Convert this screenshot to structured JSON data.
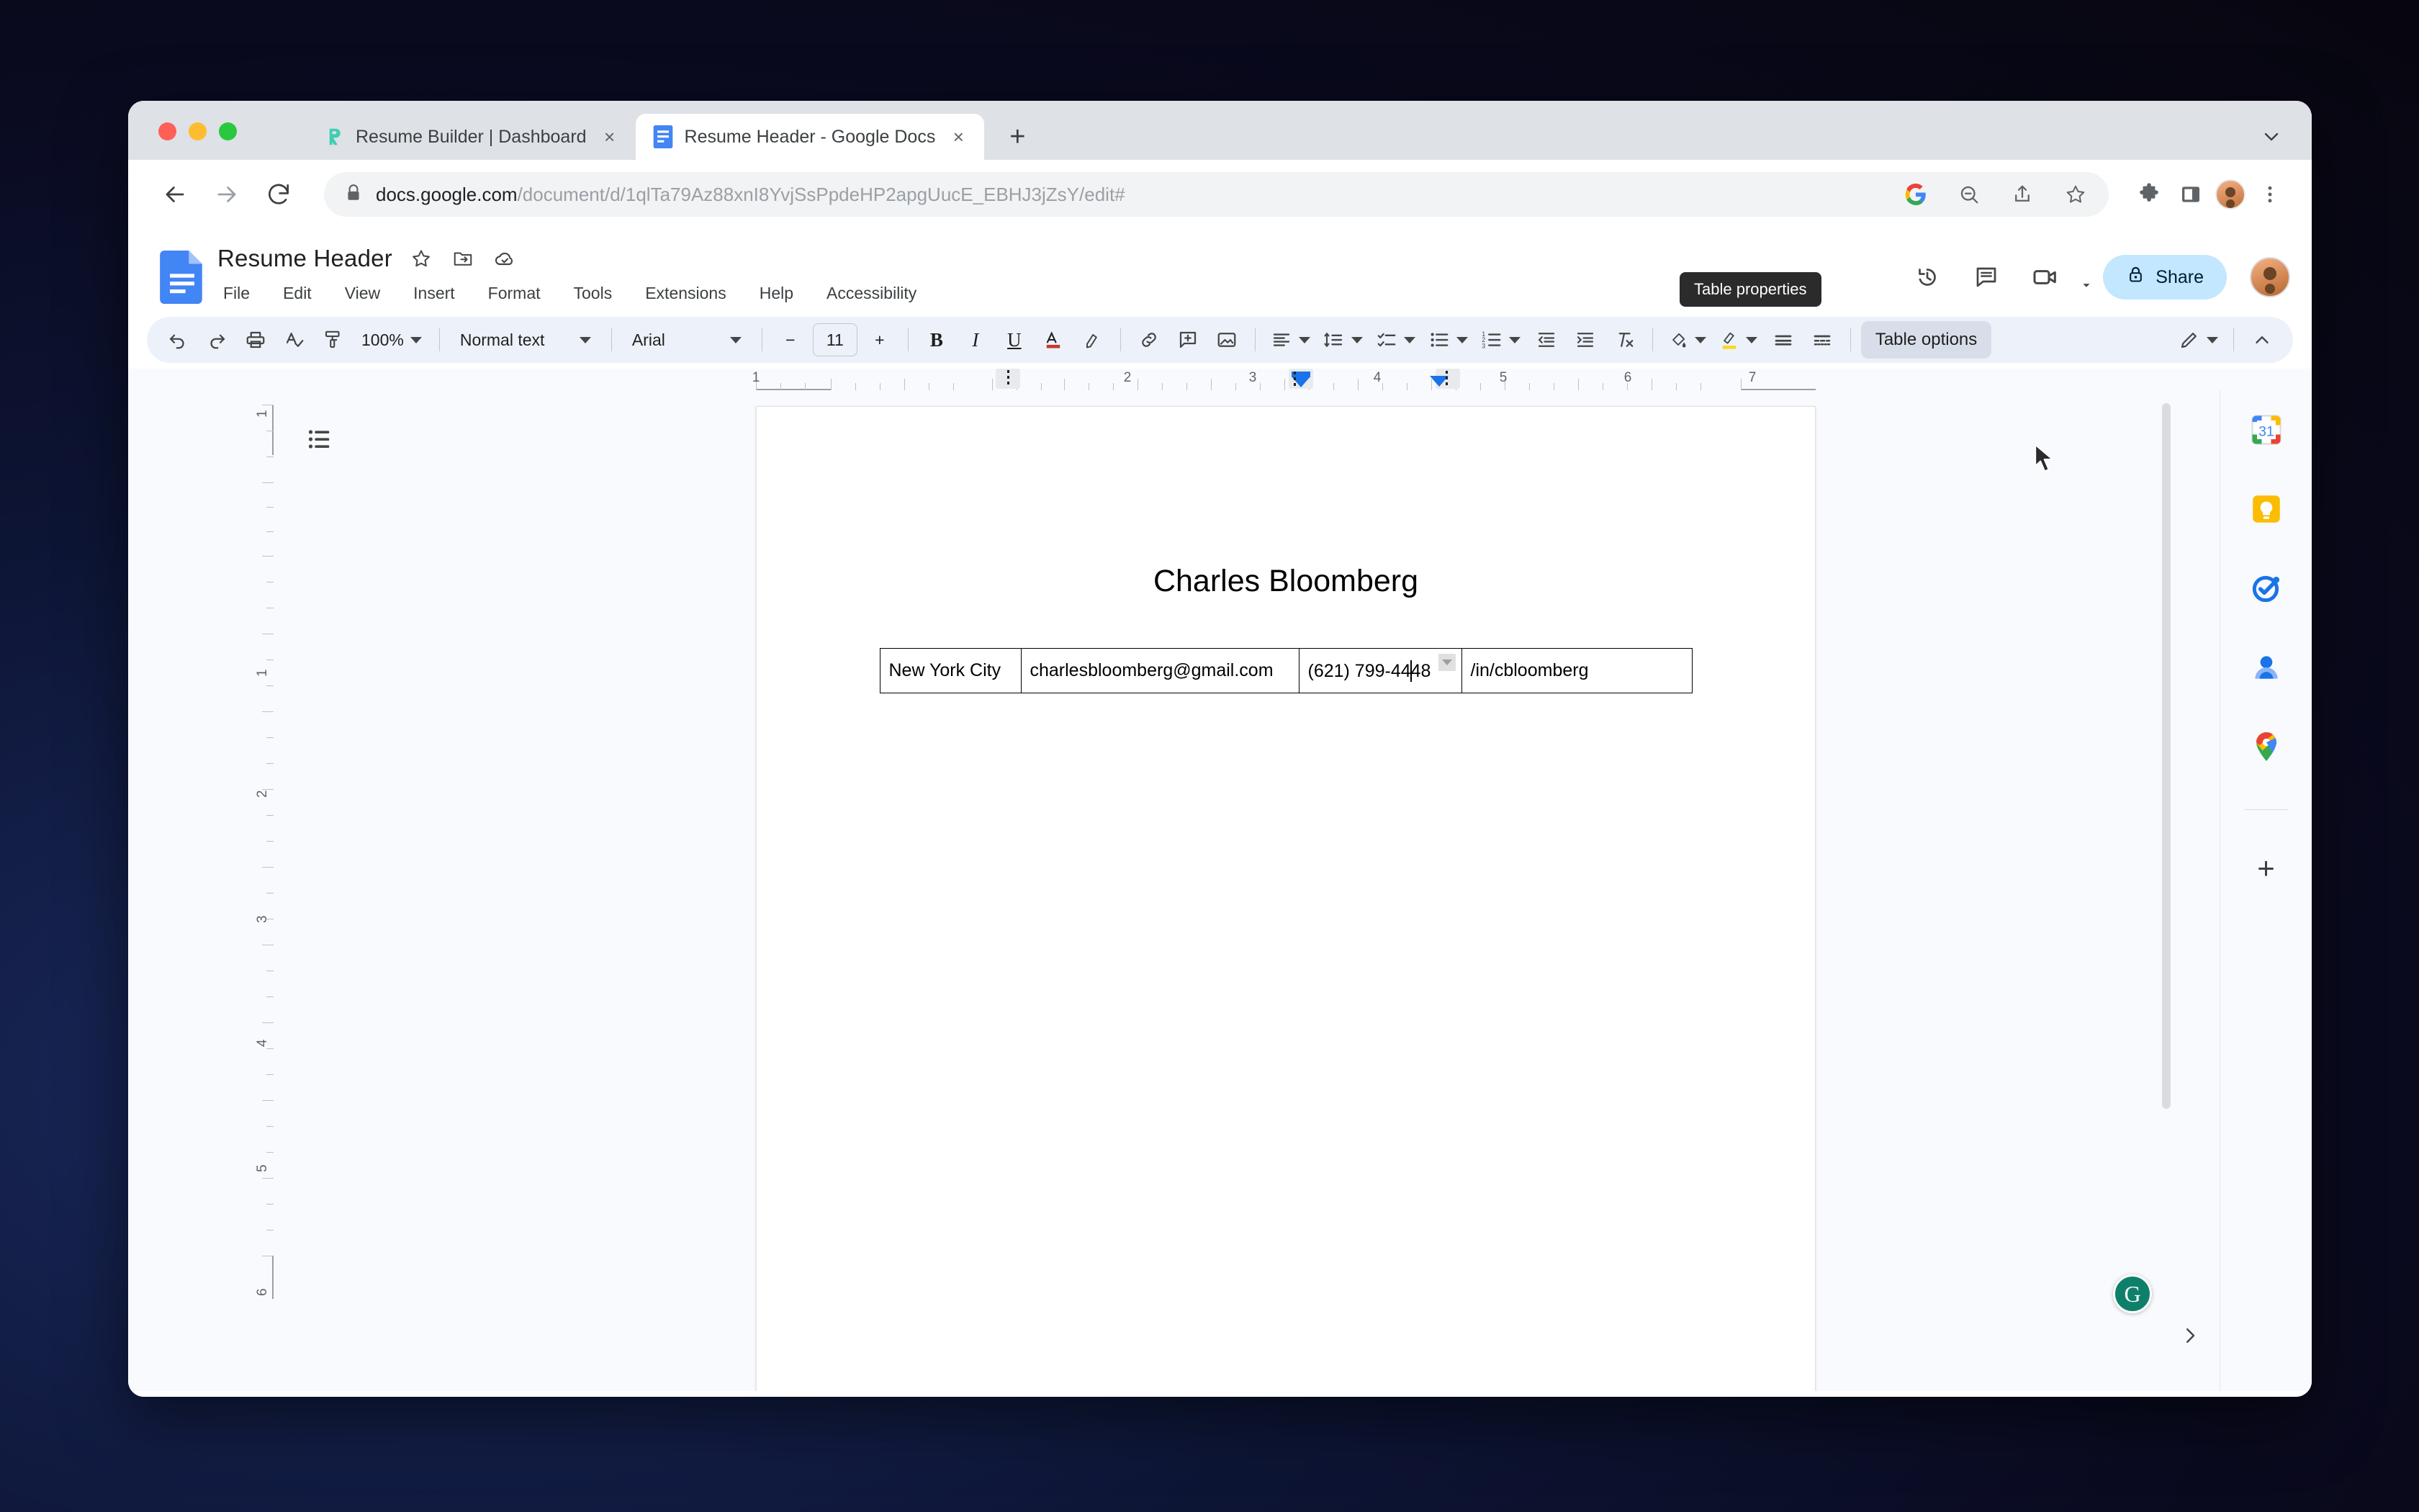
{
  "browser": {
    "tabs": [
      {
        "title": "Resume Builder | Dashboard",
        "favicon": "resume-builder-icon",
        "active": false,
        "close_label": "×"
      },
      {
        "title": "Resume Header - Google Docs",
        "favicon": "google-docs-icon",
        "active": true,
        "close_label": "×"
      }
    ],
    "new_tab_label": "+",
    "tabstrip_menu_icon": "chevron-down-icon",
    "nav": {
      "back_icon": "back-arrow-icon",
      "forward_icon": "forward-arrow-icon",
      "reload_icon": "reload-icon"
    },
    "omnibox": {
      "lock_icon": "lock-icon",
      "host": "docs.google.com",
      "path": "/document/d/1qlTa79Az88xnI8YvjSsPpdeHP2apgUucE_EBHJ3jZsY/edit#",
      "actions": [
        "google-g-icon",
        "zoom-out-icon",
        "share-icon",
        "bookmark-star-icon"
      ]
    },
    "toolbar_right": [
      "extensions-puzzle-icon",
      "side-panel-icon",
      "profile-avatar",
      "more-options-icon"
    ]
  },
  "docs": {
    "title": "Resume Header",
    "title_icons": [
      "star-icon",
      "move-to-folder-icon",
      "cloud-saved-icon"
    ],
    "menus": [
      "File",
      "Edit",
      "View",
      "Insert",
      "Format",
      "Tools",
      "Extensions",
      "Help",
      "Accessibility"
    ],
    "header_actions": [
      "version-history-icon",
      "comment-icon",
      "meet-camera-icon"
    ],
    "share": {
      "label": "Share",
      "icon": "lock-icon",
      "color": "#c2e7ff"
    },
    "toolbar": {
      "undo": "undo-icon",
      "redo": "redo-icon",
      "print": "print-icon",
      "spellcheck": "spellcheck-icon",
      "paint_format": "paint-format-icon",
      "zoom_value": "100%",
      "style_value": "Normal text",
      "font_value": "Arial",
      "font_size_decrease": "−",
      "font_size_value": "11",
      "font_size_increase": "+",
      "bold": "B",
      "italic": "I",
      "underline": "U",
      "text_color": "A",
      "highlight": "highlight-pen-icon",
      "insert_link": "link-icon",
      "add_comment": "add-comment-icon",
      "insert_image": "insert-image-icon",
      "align": "align-left-icon",
      "line_spacing": "line-spacing-icon",
      "checklist": "checklist-icon",
      "bulleted_list": "bulleted-list-icon",
      "numbered_list": "numbered-list-icon",
      "decrease_indent": "decrease-indent-icon",
      "increase_indent": "increase-indent-icon",
      "clear_formatting": "clear-formatting-icon",
      "cell_fill": "cell-fill-icon",
      "border_color": "border-color-icon",
      "border_width": "border-width-icon",
      "border_dash": "border-dash-icon",
      "table_options_label": "Table options",
      "editing_mode": "edit-pencil-icon",
      "collapse": "collapse-chevron-icon"
    },
    "tooltip": {
      "text": "Table properties"
    },
    "ruler": {
      "horizontal_labels": [
        "1",
        "1",
        "2",
        "3",
        "4",
        "5",
        "6",
        "7"
      ],
      "vertical_labels": [
        "1",
        "1",
        "2",
        "3",
        "4",
        "5",
        "6"
      ]
    },
    "outline_icon": "document-outline-icon",
    "document": {
      "name": "Charles Bloomberg",
      "table": {
        "rows": [
          [
            "New York City",
            "charlesbloomberg@gmail.com",
            "(621) 799-4448",
            "/in/cbloomberg"
          ]
        ],
        "caret_cell": 2,
        "caret_after": "(621) 799-44",
        "caret_rest": "48"
      }
    },
    "side_panel": {
      "items": [
        "google-calendar-icon",
        "google-keep-icon",
        "google-tasks-icon",
        "google-contacts-icon",
        "google-maps-icon"
      ],
      "add_label": "+"
    },
    "grammarly": {
      "label": "G"
    },
    "panel_expand_icon": "chevron-right-icon"
  }
}
